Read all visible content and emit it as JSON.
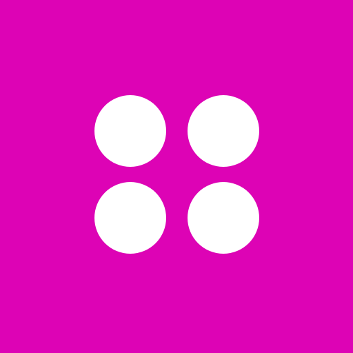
{
  "icon": {
    "name": "four-dots-grid-icon",
    "background_color": "#dd03b5",
    "dot_color": "#ffffff",
    "dot_count": 4
  }
}
